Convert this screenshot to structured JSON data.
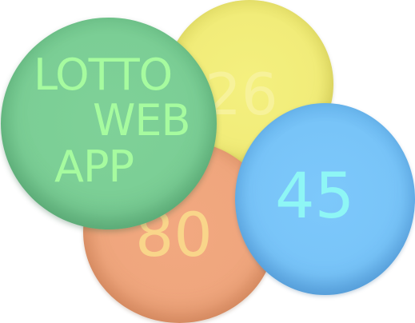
{
  "logo": {
    "title_lines": [
      "LOTTO",
      "WEB",
      "APP"
    ]
  },
  "balls": {
    "yellow": {
      "number": "26",
      "color": "#f1ec79"
    },
    "orange": {
      "number": "80",
      "color": "#efa67d"
    },
    "blue": {
      "number": "45",
      "color": "#78c4f8"
    },
    "green": {
      "color": "#7bce95"
    }
  },
  "colors": {
    "title_text": "#a6fb9f",
    "yellow_number": "#f7f29a",
    "orange_number": "#f9d58a",
    "blue_number": "#8ef6f5"
  }
}
